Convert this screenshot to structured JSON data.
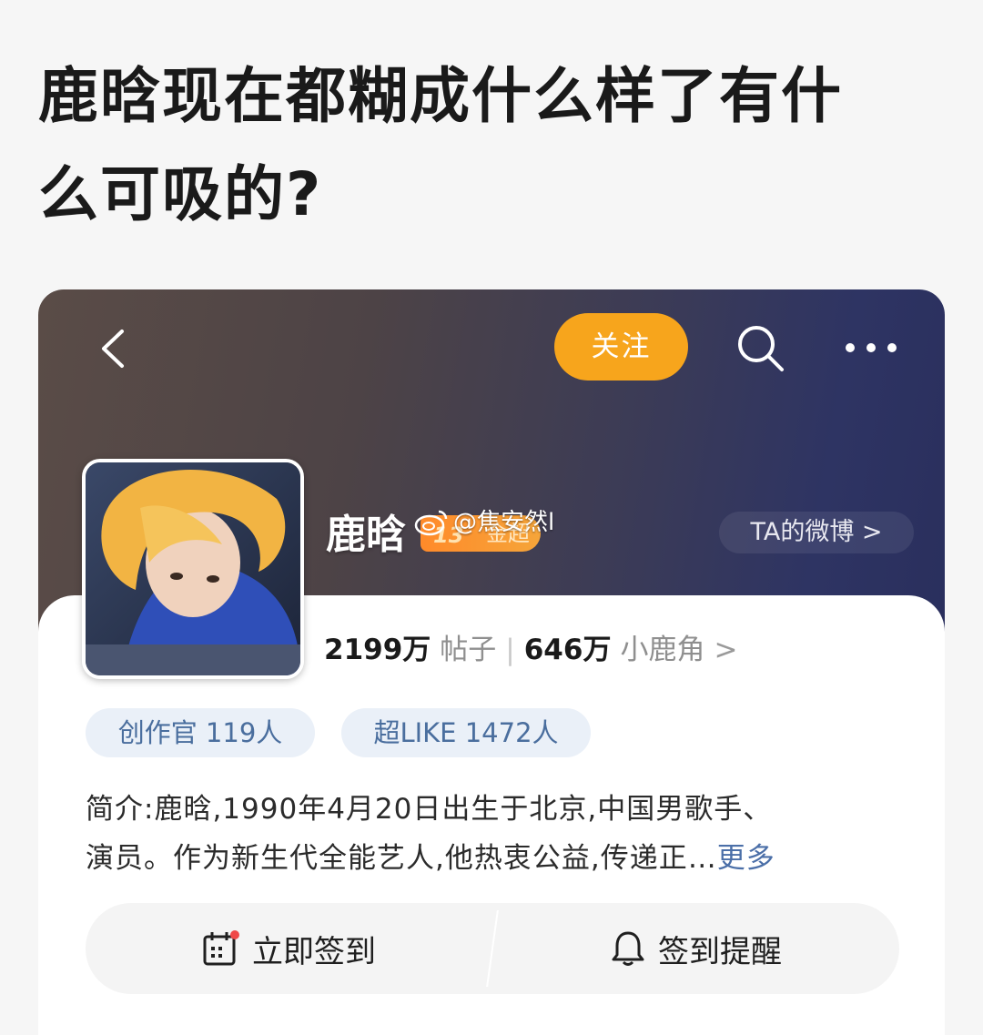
{
  "post": {
    "title_line1": "鹿晗现在都糊成什么样了有什",
    "title_line2": "么可吸的?"
  },
  "header": {
    "follow_label": "关注"
  },
  "profile": {
    "name": "鹿晗",
    "badge_level": "13",
    "badge_label": "金超",
    "watermark": "@焦安然l",
    "ta_weibo_label": "TA的微博 >",
    "posts_count": "2199万",
    "posts_label": "帖子",
    "separator": "|",
    "fans_count": "646万",
    "fans_label": "小鹿角",
    "fans_arrow": ">"
  },
  "pills": [
    {
      "label": "创作官 119人"
    },
    {
      "label": "超LIKE 1472人"
    }
  ],
  "intro": {
    "line1": "简介:鹿晗,1990年4月20日出生于北京,中国男歌手、",
    "line2": "演员。作为新生代全能艺人,他热衷公益,传递正…",
    "more": "更多"
  },
  "actions": {
    "checkin_label": "立即签到",
    "reminder_label": "签到提醒"
  },
  "colors": {
    "follow": "#f7a51c",
    "pill_bg": "#eaf0f8",
    "pill_text": "#4a6e9e",
    "more_link": "#4b6fa8"
  }
}
